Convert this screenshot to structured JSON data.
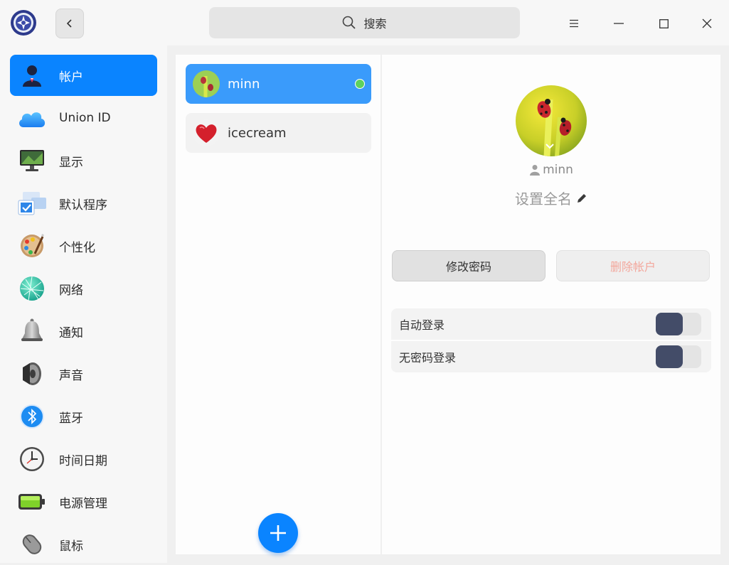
{
  "titlebar": {
    "search_placeholder": "搜索",
    "icons": {
      "logo": "control-center-logo-icon",
      "back": "chevron-left-icon",
      "search": "search-icon",
      "menu": "hamburger-menu-icon",
      "minimize": "minimize-icon",
      "maximize": "maximize-icon",
      "close": "close-icon"
    }
  },
  "sidebar": {
    "accent": "#0a84ff",
    "items": [
      {
        "label": "帐户",
        "icon": "user-account-icon",
        "active": true
      },
      {
        "label": "Union ID",
        "icon": "cloud-icon"
      },
      {
        "label": "显示",
        "icon": "monitor-icon"
      },
      {
        "label": "默认程序",
        "icon": "default-apps-icon"
      },
      {
        "label": "个性化",
        "icon": "palette-icon"
      },
      {
        "label": "网络",
        "icon": "network-globe-icon"
      },
      {
        "label": "通知",
        "icon": "bell-icon"
      },
      {
        "label": "声音",
        "icon": "speaker-icon"
      },
      {
        "label": "蓝牙",
        "icon": "bluetooth-icon"
      },
      {
        "label": "时间日期",
        "icon": "clock-icon"
      },
      {
        "label": "电源管理",
        "icon": "battery-icon"
      },
      {
        "label": "鼠标",
        "icon": "mouse-icon"
      }
    ]
  },
  "accounts": {
    "list": [
      {
        "name": "minn",
        "online": true,
        "avatar": "ladybug-avatar"
      },
      {
        "name": "icecream",
        "online": false,
        "avatar": "heart-avatar"
      }
    ],
    "add_icon": "plus-icon"
  },
  "detail": {
    "username": "minn",
    "fullname_placeholder": "设置全名",
    "change_password": "修改密码",
    "delete_account": "删除帐户",
    "settings": [
      {
        "label": "自动登录",
        "enabled": false
      },
      {
        "label": "无密码登录",
        "enabled": false
      }
    ]
  }
}
